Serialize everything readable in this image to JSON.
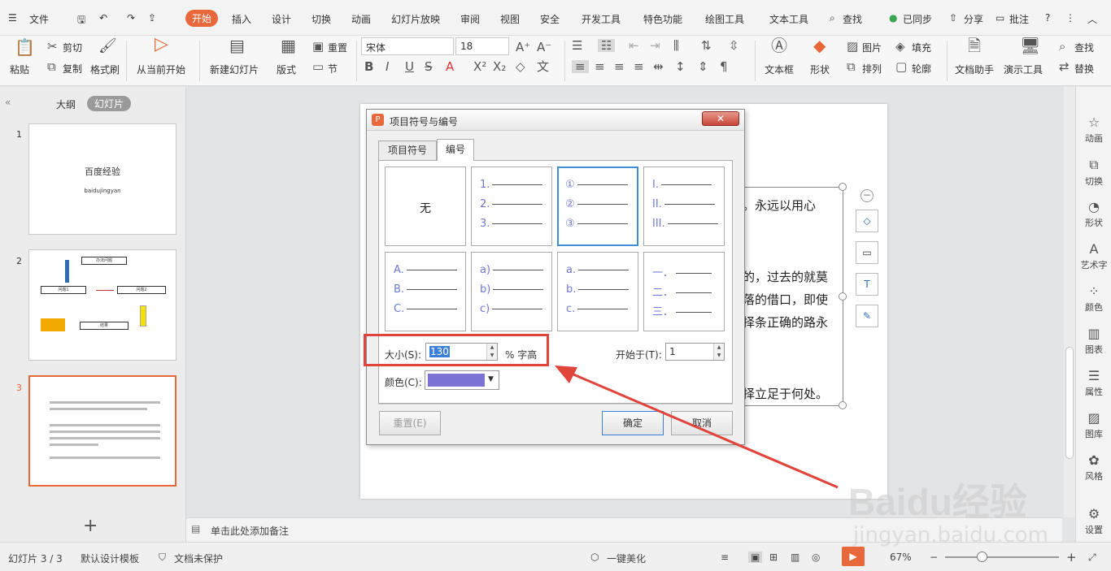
{
  "menu": {
    "file": "文件",
    "start": "开始",
    "insert": "插入",
    "design": "设计",
    "transition": "切换",
    "animation": "动画",
    "slideshow": "幻灯片放映",
    "review": "审阅",
    "view": "视图",
    "security": "安全",
    "developer": "开发工具",
    "special": "特色功能",
    "drawing": "绘图工具",
    "textool": "文本工具",
    "search": "查找",
    "sync": "已同步",
    "share": "分享",
    "comment": "批注"
  },
  "ribbon": {
    "paste": "粘贴",
    "cut": "剪切",
    "copy": "复制",
    "format_painter": "格式刷",
    "from_current": "从当前开始",
    "new_slide": "新建幻灯片",
    "layout": "版式",
    "reset": "重置",
    "section": "节",
    "font": "宋体",
    "font_size": "18",
    "textbox": "文本框",
    "shape": "形状",
    "picture": "图片",
    "fill": "填充",
    "arrange": "排列",
    "outline": "轮廓",
    "doc_helper": "文档助手",
    "present_tool": "演示工具",
    "find": "查找",
    "replace": "替换"
  },
  "left_panel": {
    "tab_outline": "大纲",
    "tab_slides": "幻灯片",
    "add": "+",
    "slides": [
      {
        "num": "1",
        "title": "百度经验",
        "subtitle": "baidujingyan"
      },
      {
        "num": "2",
        "boxes": [
          "办法问题",
          "问题1",
          "问题2",
          "结果"
        ]
      },
      {
        "num": "3"
      }
    ]
  },
  "slide": {
    "lines": [
      "。永远以用心",
      "的，过去的就莫",
      "落的借口，即使",
      "择条正确的路永",
      "择立足于何处。"
    ]
  },
  "notes": {
    "placeholder": "单击此处添加备注"
  },
  "dialog": {
    "title": "项目符号与编号",
    "tab_bullets": "项目符号",
    "tab_numbering": "编号",
    "styles": [
      {
        "none": "无"
      },
      {
        "items": [
          "1.",
          "2.",
          "3."
        ]
      },
      {
        "items": [
          "①",
          "②",
          "③"
        ]
      },
      {
        "items": [
          "I.",
          "II.",
          "III."
        ]
      },
      {
        "items": [
          "A.",
          "B.",
          "C."
        ]
      },
      {
        "items": [
          "a)",
          "b)",
          "c)"
        ]
      },
      {
        "items": [
          "a.",
          "b.",
          "c."
        ]
      },
      {
        "items": [
          "一．",
          "二．",
          "三．"
        ]
      }
    ],
    "size_label": "大小(S):",
    "size_value": "130",
    "size_unit": "% 字高",
    "start_label": "开始于(T):",
    "start_value": "1",
    "color_label": "颜色(C):",
    "color": "#7b72d6",
    "reset": "重置(E)",
    "ok": "确定",
    "cancel": "取消"
  },
  "right_bar": [
    {
      "icon": "star-icon",
      "label": "动画"
    },
    {
      "icon": "transition-icon",
      "label": "切换"
    },
    {
      "icon": "shape-icon",
      "label": "形状"
    },
    {
      "icon": "wordart-icon",
      "label": "艺术字"
    },
    {
      "icon": "color-icon",
      "label": "颜色"
    },
    {
      "icon": "chart-icon",
      "label": "图表"
    },
    {
      "icon": "properties-icon",
      "label": "属性"
    },
    {
      "icon": "gallery-icon",
      "label": "图库"
    },
    {
      "icon": "style-icon",
      "label": "风格"
    },
    {
      "icon": "settings-icon",
      "label": "设置"
    }
  ],
  "status": {
    "slide": "幻灯片 3 / 3",
    "template": "默认设计模板",
    "protect": "文档未保护",
    "beautify": "一键美化",
    "zoom": "67%"
  },
  "watermark": {
    "logo": "Baidu经验",
    "url": "jingyan.baidu.com"
  },
  "colors": {
    "accent": "#e8683c",
    "highlight": "#e0443a",
    "bullet": "#6f78d6"
  }
}
